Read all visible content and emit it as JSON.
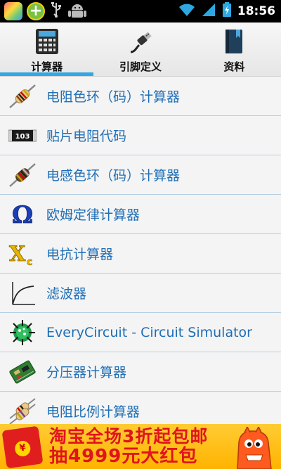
{
  "status_bar": {
    "time": "18:56",
    "notification_icons": [
      "photo-app-icon",
      "plus-app-icon",
      "usb-icon",
      "android-debug-icon"
    ],
    "system_icons": [
      "wifi-icon",
      "signal-icon",
      "battery-icon"
    ]
  },
  "tabs": [
    {
      "label": "计算器",
      "icon": "calculator-icon",
      "active": true
    },
    {
      "label": "引脚定义",
      "icon": "usb-plug-icon",
      "active": false
    },
    {
      "label": "资料",
      "icon": "book-icon",
      "active": false
    }
  ],
  "items": [
    {
      "label": "电阻色环（码）计算器",
      "icon": "resistor-icon"
    },
    {
      "label": "贴片电阻代码",
      "icon": "smd-resistor-icon",
      "icon_text": "103"
    },
    {
      "label": "电感色环（码）计算器",
      "icon": "inductor-icon"
    },
    {
      "label": "欧姆定律计算器",
      "icon": "omega-icon",
      "icon_text": "Ω"
    },
    {
      "label": "电抗计算器",
      "icon": "reactance-icon",
      "icon_text": "X",
      "icon_sub": "c"
    },
    {
      "label": "滤波器",
      "icon": "filter-curve-icon"
    },
    {
      "label": "EveryCircuit - Circuit Simulator",
      "icon": "everycircuit-icon"
    },
    {
      "label": "分压器计算器",
      "icon": "circuit-board-icon"
    },
    {
      "label": "电阻比例计算器",
      "icon": "resistor-ratio-icon"
    }
  ],
  "ad": {
    "line1": "淘宝全场3折起包邮",
    "line2": "抽4999元大红包",
    "seal_text": "¥"
  },
  "colors": {
    "accent": "#32a7e6",
    "item_text": "#1f6eb5",
    "divider": "#b6cfe2",
    "ad_background": "#ffc21a",
    "ad_text": "#e0141e"
  }
}
